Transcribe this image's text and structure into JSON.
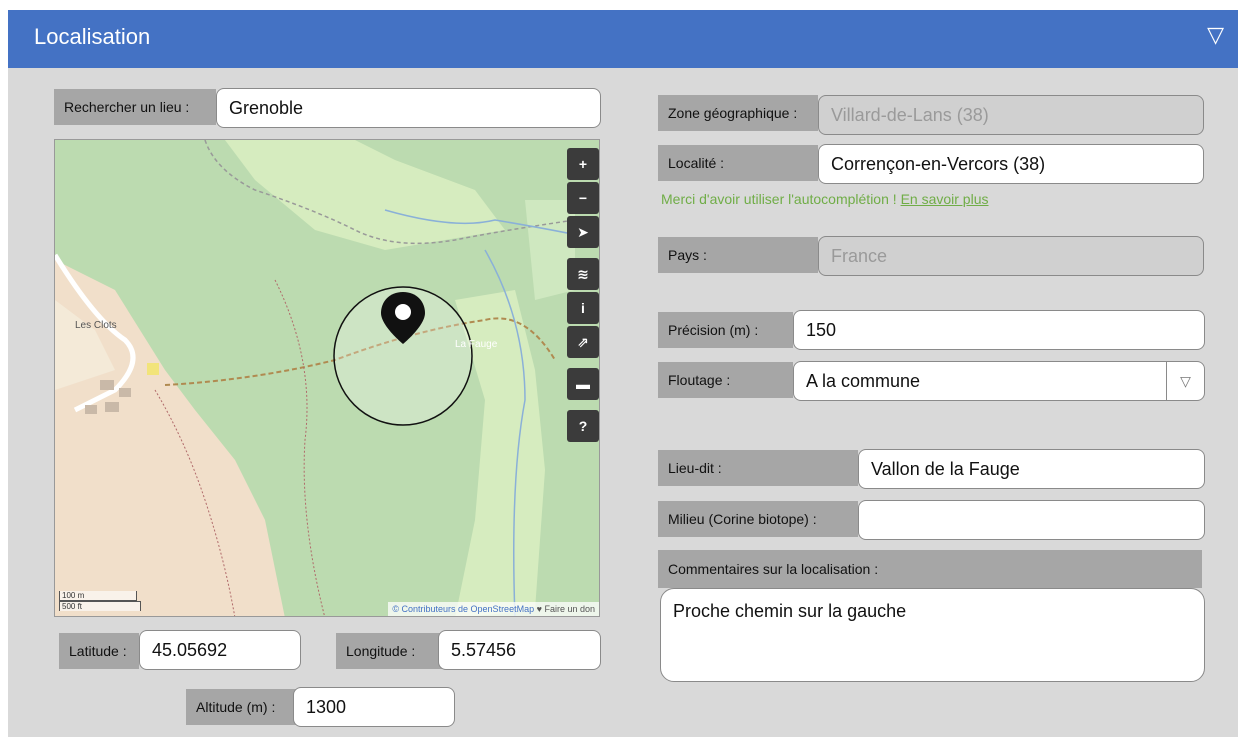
{
  "header": {
    "title": "Localisation",
    "toggle_icon": "triangle-down-outline-icon"
  },
  "search": {
    "label": "Rechercher un lieu :",
    "value": "Grenoble"
  },
  "map": {
    "controls": [
      {
        "name": "zoom-in",
        "glyph": "+"
      },
      {
        "name": "zoom-out",
        "glyph": "−"
      },
      {
        "name": "locate",
        "glyph": "➤"
      },
      {
        "name": "layers",
        "glyph": "≋"
      },
      {
        "name": "info",
        "glyph": "i"
      },
      {
        "name": "share",
        "glyph": "⇗"
      },
      {
        "name": "comment",
        "glyph": "▬"
      },
      {
        "name": "help",
        "glyph": "?"
      }
    ],
    "place_labels": {
      "les_clots": "Les Clots",
      "la_fauge": "La Fauge"
    },
    "scale": {
      "metric": "100 m",
      "imperial": "500 ft"
    },
    "attribution": {
      "osm": "© Contributeurs de OpenStreetMap",
      "donate": "♥ Faire un don"
    }
  },
  "coords": {
    "latitude_label": "Latitude :",
    "latitude": "45.05692",
    "longitude_label": "Longitude :",
    "longitude": "5.57456",
    "altitude_label": "Altitude (m) :",
    "altitude": "1300"
  },
  "right": {
    "zone_label": "Zone géographique :",
    "zone_value": "Villard-de-Lans (38)",
    "localite_label": "Localité :",
    "localite_value": "Corrençon-en-Vercors (38)",
    "help_text": "Merci d'avoir utiliser l'autocomplétion ! ",
    "help_link": "En savoir plus",
    "pays_label": "Pays :",
    "pays_value": "France",
    "precision_label": "Précision (m) :",
    "precision_value": "150",
    "floutage_label": "Floutage :",
    "floutage_value": "A la commune",
    "lieudit_label": "Lieu-dit :",
    "lieudit_value": "Vallon de la Fauge",
    "milieu_label": "Milieu (Corine biotope) :",
    "milieu_value": "",
    "comment_label": "Commentaires sur la localisation :",
    "comment_value": "Proche chemin sur la gauche"
  },
  "colors": {
    "header": "#4472c4",
    "panel": "#d9d9d9",
    "label_bg": "#a6a6a6",
    "help": "#70ad47"
  }
}
